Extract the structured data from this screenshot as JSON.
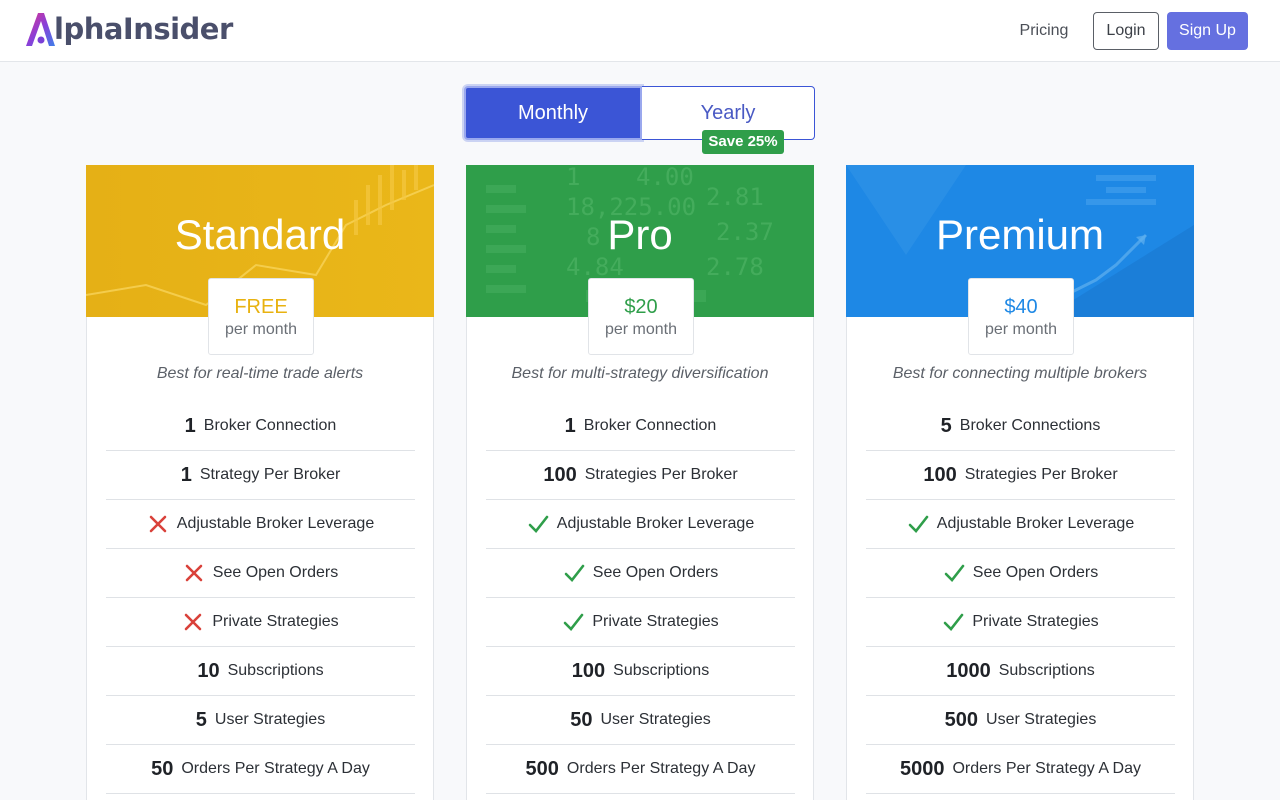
{
  "brand": {
    "name": "AlphaInsider",
    "logo_rest": "lphaInsider"
  },
  "nav": {
    "pricing": "Pricing",
    "login": "Login",
    "signup": "Sign Up"
  },
  "billing": {
    "monthly": "Monthly",
    "yearly": "Yearly",
    "save_badge": "Save 25%"
  },
  "colors": {
    "accent": "#3b55d6",
    "standard": "#e8b210",
    "pro": "#2f9e4a",
    "premium": "#1e88e5",
    "check": "#2f9e4a",
    "cross": "#d9413a"
  },
  "plans": [
    {
      "name": "Standard",
      "price": "FREE",
      "period": "per month",
      "tagline": "Best for real-time trade alerts",
      "features": [
        {
          "value": "1",
          "label": "Broker Connection"
        },
        {
          "value": "1",
          "label": "Strategy Per Broker"
        },
        {
          "icon": "cross-icon",
          "label": "Adjustable Broker Leverage"
        },
        {
          "icon": "cross-icon",
          "label": "See Open Orders"
        },
        {
          "icon": "cross-icon",
          "label": "Private Strategies"
        },
        {
          "value": "10",
          "label": "Subscriptions"
        },
        {
          "value": "5",
          "label": "User Strategies"
        },
        {
          "value": "50",
          "label": "Orders Per Strategy A Day"
        }
      ]
    },
    {
      "name": "Pro",
      "price": "$20",
      "period": "per month",
      "tagline": "Best for multi-strategy diversification",
      "features": [
        {
          "value": "1",
          "label": "Broker Connection"
        },
        {
          "value": "100",
          "label": "Strategies Per Broker"
        },
        {
          "icon": "check-icon",
          "label": "Adjustable Broker Leverage"
        },
        {
          "icon": "check-icon",
          "label": "See Open Orders"
        },
        {
          "icon": "check-icon",
          "label": "Private Strategies"
        },
        {
          "value": "100",
          "label": "Subscriptions"
        },
        {
          "value": "50",
          "label": "User Strategies"
        },
        {
          "value": "500",
          "label": "Orders Per Strategy A Day"
        }
      ]
    },
    {
      "name": "Premium",
      "price": "$40",
      "period": "per month",
      "tagline": "Best for connecting multiple brokers",
      "features": [
        {
          "value": "5",
          "label": "Broker Connections"
        },
        {
          "value": "100",
          "label": "Strategies Per Broker"
        },
        {
          "icon": "check-icon",
          "label": "Adjustable Broker Leverage"
        },
        {
          "icon": "check-icon",
          "label": "See Open Orders"
        },
        {
          "icon": "check-icon",
          "label": "Private Strategies"
        },
        {
          "value": "1000",
          "label": "Subscriptions"
        },
        {
          "value": "500",
          "label": "User Strategies"
        },
        {
          "value": "5000",
          "label": "Orders Per Strategy A Day"
        }
      ]
    }
  ]
}
